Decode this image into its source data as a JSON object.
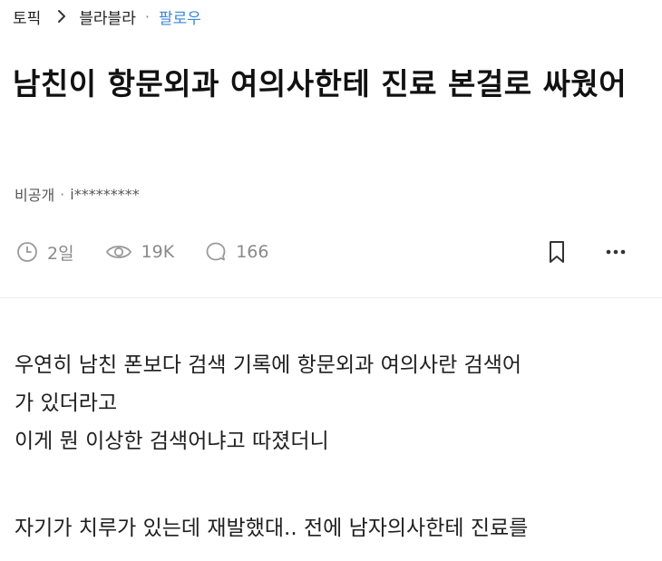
{
  "breadcrumb": {
    "topic": "토픽",
    "board": "블라블라",
    "follow": "팔로우"
  },
  "post": {
    "title": "남친이 항문외과 여의사한테 진료 본걸로 싸웠어",
    "author_company": "비공개",
    "author_sep": "·",
    "author_name": "i*********",
    "time": "2일",
    "views": "19K",
    "comments": "166",
    "body_lines": [
      "우연히 남친 폰보다 검색 기록에 항문외과 여의사란 검색어",
      "가 있더라고",
      "이게 뭔 이상한 검색어냐고 따졌더니",
      "",
      "자기가 치루가 있는데 재발했대.. 전에 남자의사한테 진료를"
    ]
  },
  "icons": {
    "breadcrumb_chevron": "chevron-right-icon",
    "time": "clock-icon",
    "views": "eye-icon",
    "comments": "comment-bubble-icon",
    "bookmark": "bookmark-icon",
    "more": "more-horizontal-icon"
  },
  "colors": {
    "follow": "#3a86d8",
    "stat_gray": "#8a8a8a",
    "text": "#1f1f1f"
  }
}
